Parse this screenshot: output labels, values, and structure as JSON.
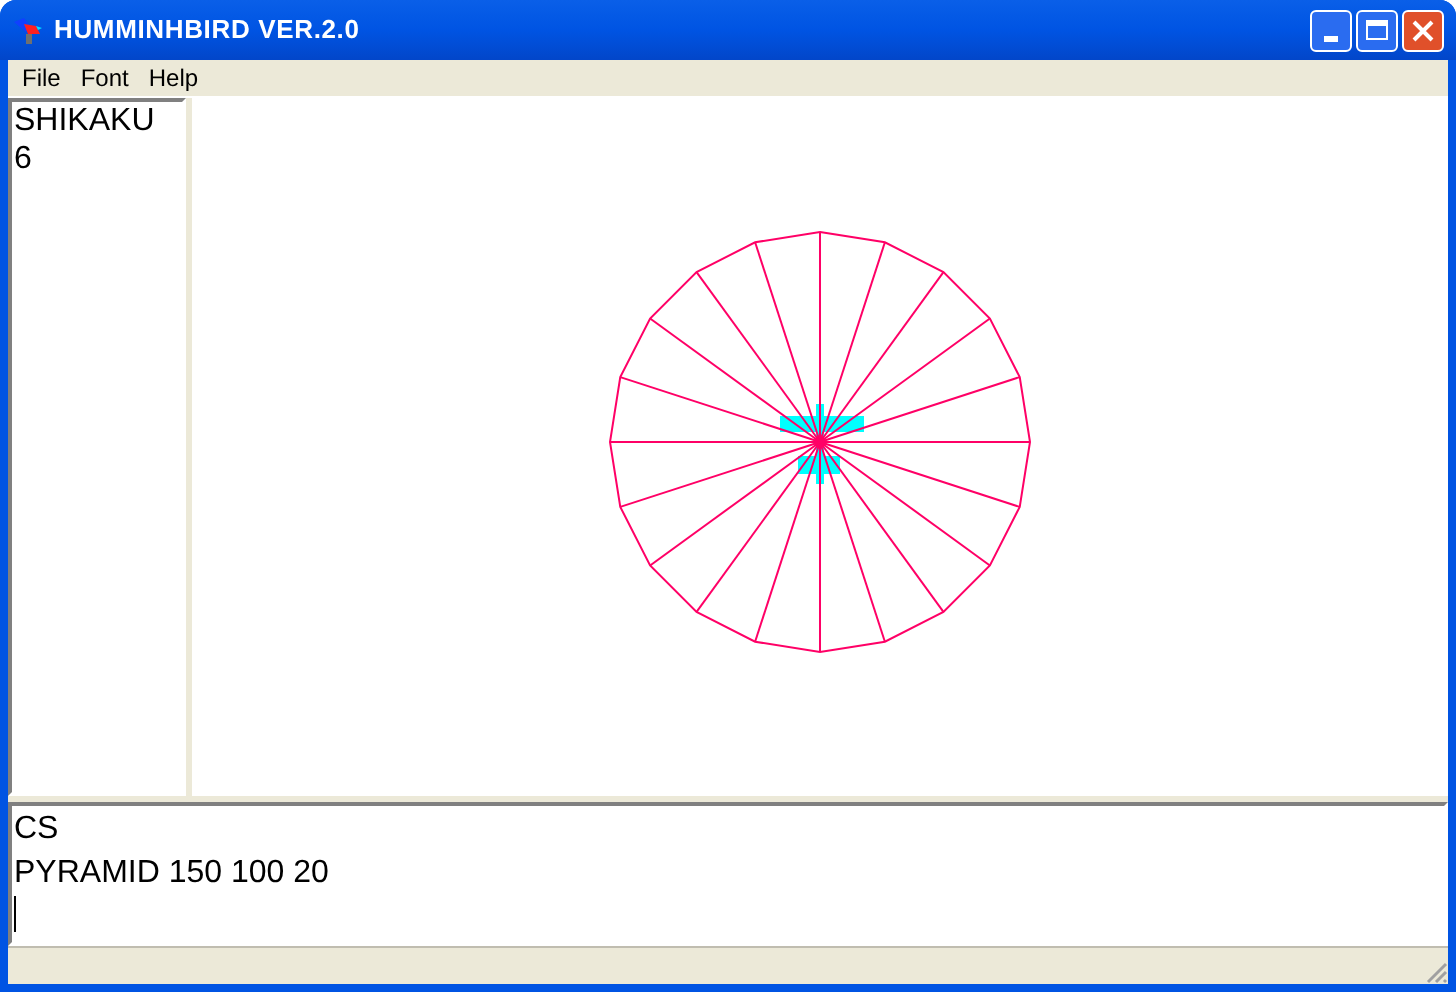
{
  "window": {
    "title": "HUMMINHBIRD VER.2.0"
  },
  "menu": [
    {
      "label": "File"
    },
    {
      "label": "Font"
    },
    {
      "label": "Help"
    }
  ],
  "info_panel": {
    "lines": [
      "SHIKAKU",
      "6"
    ]
  },
  "command_log": {
    "lines": [
      "CS",
      "PYRAMID 150 100 20"
    ]
  }
}
